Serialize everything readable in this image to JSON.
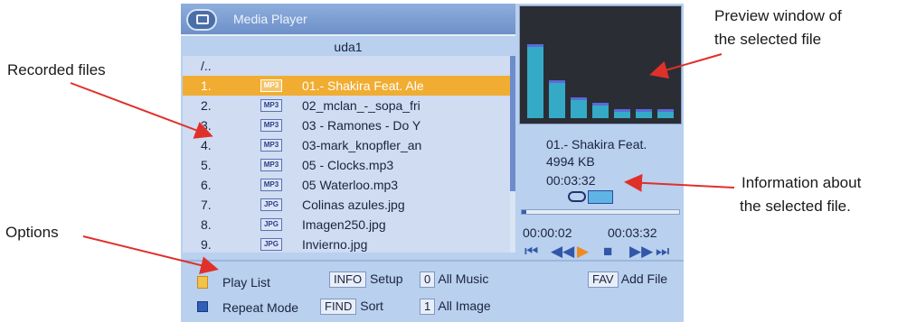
{
  "annotations": {
    "recorded_files": "Recorded files",
    "options": "Options",
    "preview_line1": "Preview window of",
    "preview_line2": "the selected file",
    "info_line1": "Information about",
    "info_line2": "the selected file."
  },
  "player": {
    "title": "Media Player",
    "folder": "uda1",
    "parent_dir": "/..",
    "files": [
      {
        "num": "1.",
        "type": "MP3",
        "name": "01.- Shakira Feat. Ale",
        "selected": true
      },
      {
        "num": "2.",
        "type": "MP3",
        "name": "02_mclan_-_sopa_fri",
        "selected": false
      },
      {
        "num": "3.",
        "type": "MP3",
        "name": "03 - Ramones - Do Y",
        "selected": false
      },
      {
        "num": "4.",
        "type": "MP3",
        "name": "03-mark_knopfler_an",
        "selected": false
      },
      {
        "num": "5.",
        "type": "MP3",
        "name": "05 - Clocks.mp3",
        "selected": false
      },
      {
        "num": "6.",
        "type": "MP3",
        "name": "05 Waterloo.mp3",
        "selected": false
      },
      {
        "num": "7.",
        "type": "JPG",
        "name": "Colinas azules.jpg",
        "selected": false
      },
      {
        "num": "8.",
        "type": "JPG",
        "name": "Imagen250.jpg",
        "selected": false
      },
      {
        "num": "9.",
        "type": "JPG",
        "name": "Invierno.jpg",
        "selected": false
      }
    ],
    "preview_bars": [
      0.68,
      0.35,
      0.19,
      0.14,
      0.08,
      0.08,
      0.08
    ],
    "info": {
      "title": "01.- Shakira Feat.",
      "size": "4994 KB",
      "duration": "00:03:32"
    },
    "progress": {
      "elapsed": "00:00:02",
      "total": "00:03:32",
      "fraction": 0.03
    },
    "controls": [
      {
        "icon": "skip-back-icon",
        "glyph": "⏮",
        "style": "normal"
      },
      {
        "icon": "rewind-icon",
        "glyph": "◀◀",
        "style": "normal"
      },
      {
        "icon": "play-icon",
        "glyph": "▶",
        "style": "play"
      },
      {
        "icon": "stop-icon",
        "glyph": "■",
        "style": "normal"
      },
      {
        "icon": "fast-forward-icon",
        "glyph": "▶▶",
        "style": "normal"
      },
      {
        "icon": "skip-forward-icon",
        "glyph": "⏭",
        "style": "normal"
      }
    ]
  },
  "footer": {
    "play_list": "Play List",
    "repeat_mode": "Repeat Mode",
    "info_key": "INFO",
    "setup": "Setup",
    "find_key": "FIND",
    "sort": "Sort",
    "key_0": "0",
    "all_music": "All Music",
    "key_1": "1",
    "all_image": "All Image",
    "fav_key": "FAV",
    "add_file": "Add File"
  },
  "colors": {
    "screen_bg": "#b9d0ee",
    "highlight": "#f0ad32",
    "arrow": "#e0302a"
  }
}
